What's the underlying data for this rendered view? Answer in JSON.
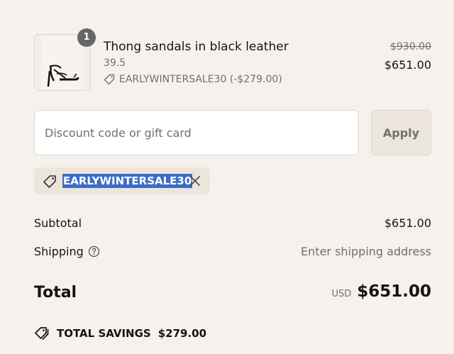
{
  "cart": {
    "quantity": "1",
    "product_name": "Thong sandals in black leather",
    "variant": "39.5",
    "discount_line": "EARLYWINTERSALE30 (-$279.00)",
    "price_original": "$930.00",
    "price_now": "$651.00",
    "thumbnail_icon": "sandal-image"
  },
  "discount": {
    "placeholder": "Discount code or gift card",
    "value": "",
    "apply_label": "Apply",
    "applied_code": "EARLYWINTERSALE30",
    "tag_icon": "tag-icon",
    "remove_icon": "close-icon"
  },
  "summary": {
    "subtotal_label": "Subtotal",
    "subtotal_value": "$651.00",
    "shipping_label": "Shipping",
    "shipping_value": "Enter shipping address",
    "shipping_help_icon": "question-circle-icon",
    "total_label": "Total",
    "currency": "USD",
    "total_value": "$651.00",
    "savings_icon": "double-tag-icon",
    "savings_label": "TOTAL SAVINGS",
    "savings_value": "$279.00"
  },
  "colors": {
    "background": "#f5f2ed",
    "selection": "#3d6cc5",
    "muted_text": "#6f6f6f"
  }
}
